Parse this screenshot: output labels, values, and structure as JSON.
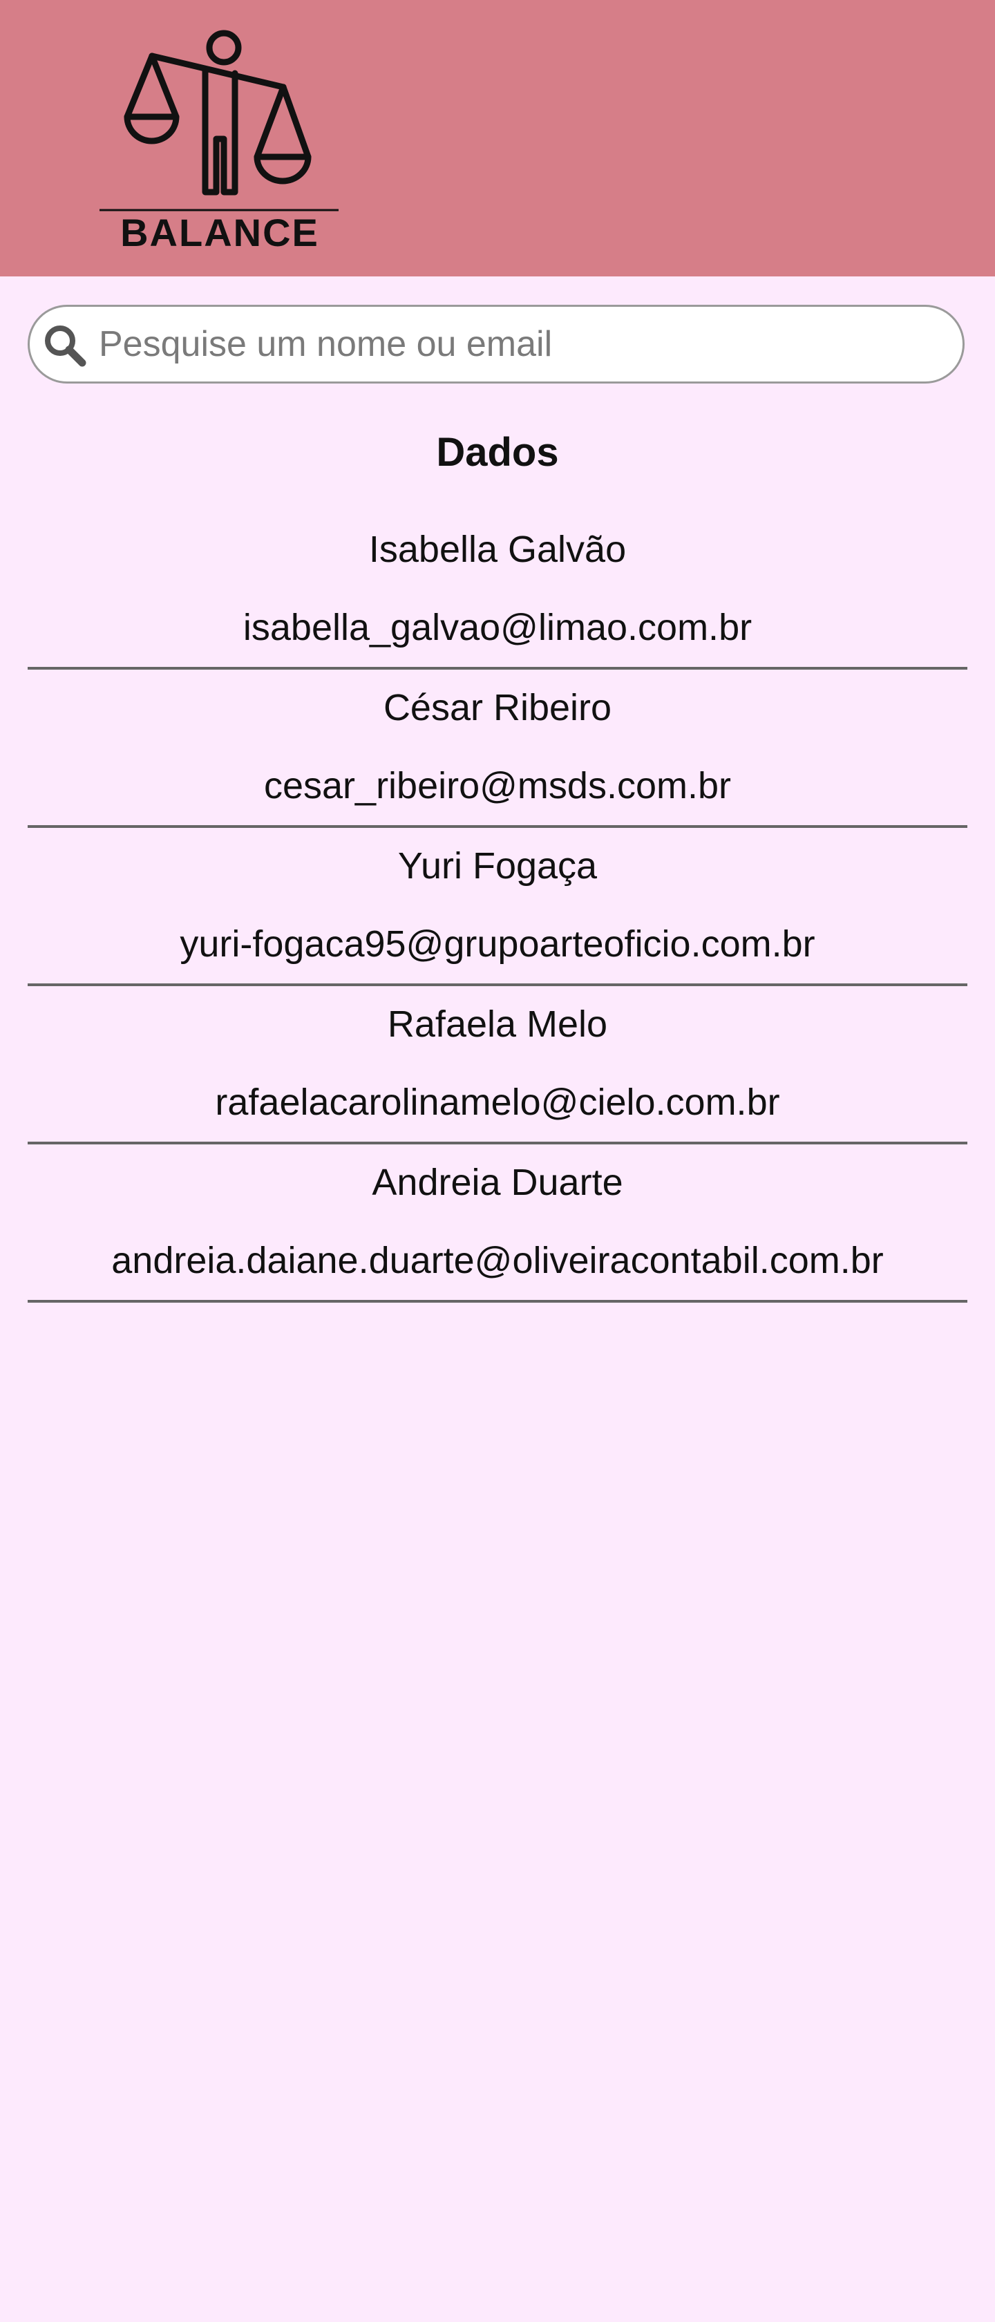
{
  "brand": {
    "logo_text": "BALANCE",
    "logo_icon": "scales-person-icon",
    "header_color": "#d67e88",
    "background_color": "#fdeafd"
  },
  "search": {
    "placeholder": "Pesquise um nome ou email",
    "value": "",
    "icon": "search-icon"
  },
  "section": {
    "title": "Dados"
  },
  "contacts": [
    {
      "name": "Isabella Galvão",
      "email": "isabella_galvao@limao.com.br"
    },
    {
      "name": "César Ribeiro",
      "email": "cesar_ribeiro@msds.com.br"
    },
    {
      "name": "Yuri Fogaça",
      "email": "yuri-fogaca95@grupoarteoficio.com.br"
    },
    {
      "name": "Rafaela Melo",
      "email": "rafaelacarolinamelo@cielo.com.br"
    },
    {
      "name": "Andreia Duarte",
      "email": "andreia.daiane.duarte@oliveiracontabil.com.br"
    }
  ]
}
